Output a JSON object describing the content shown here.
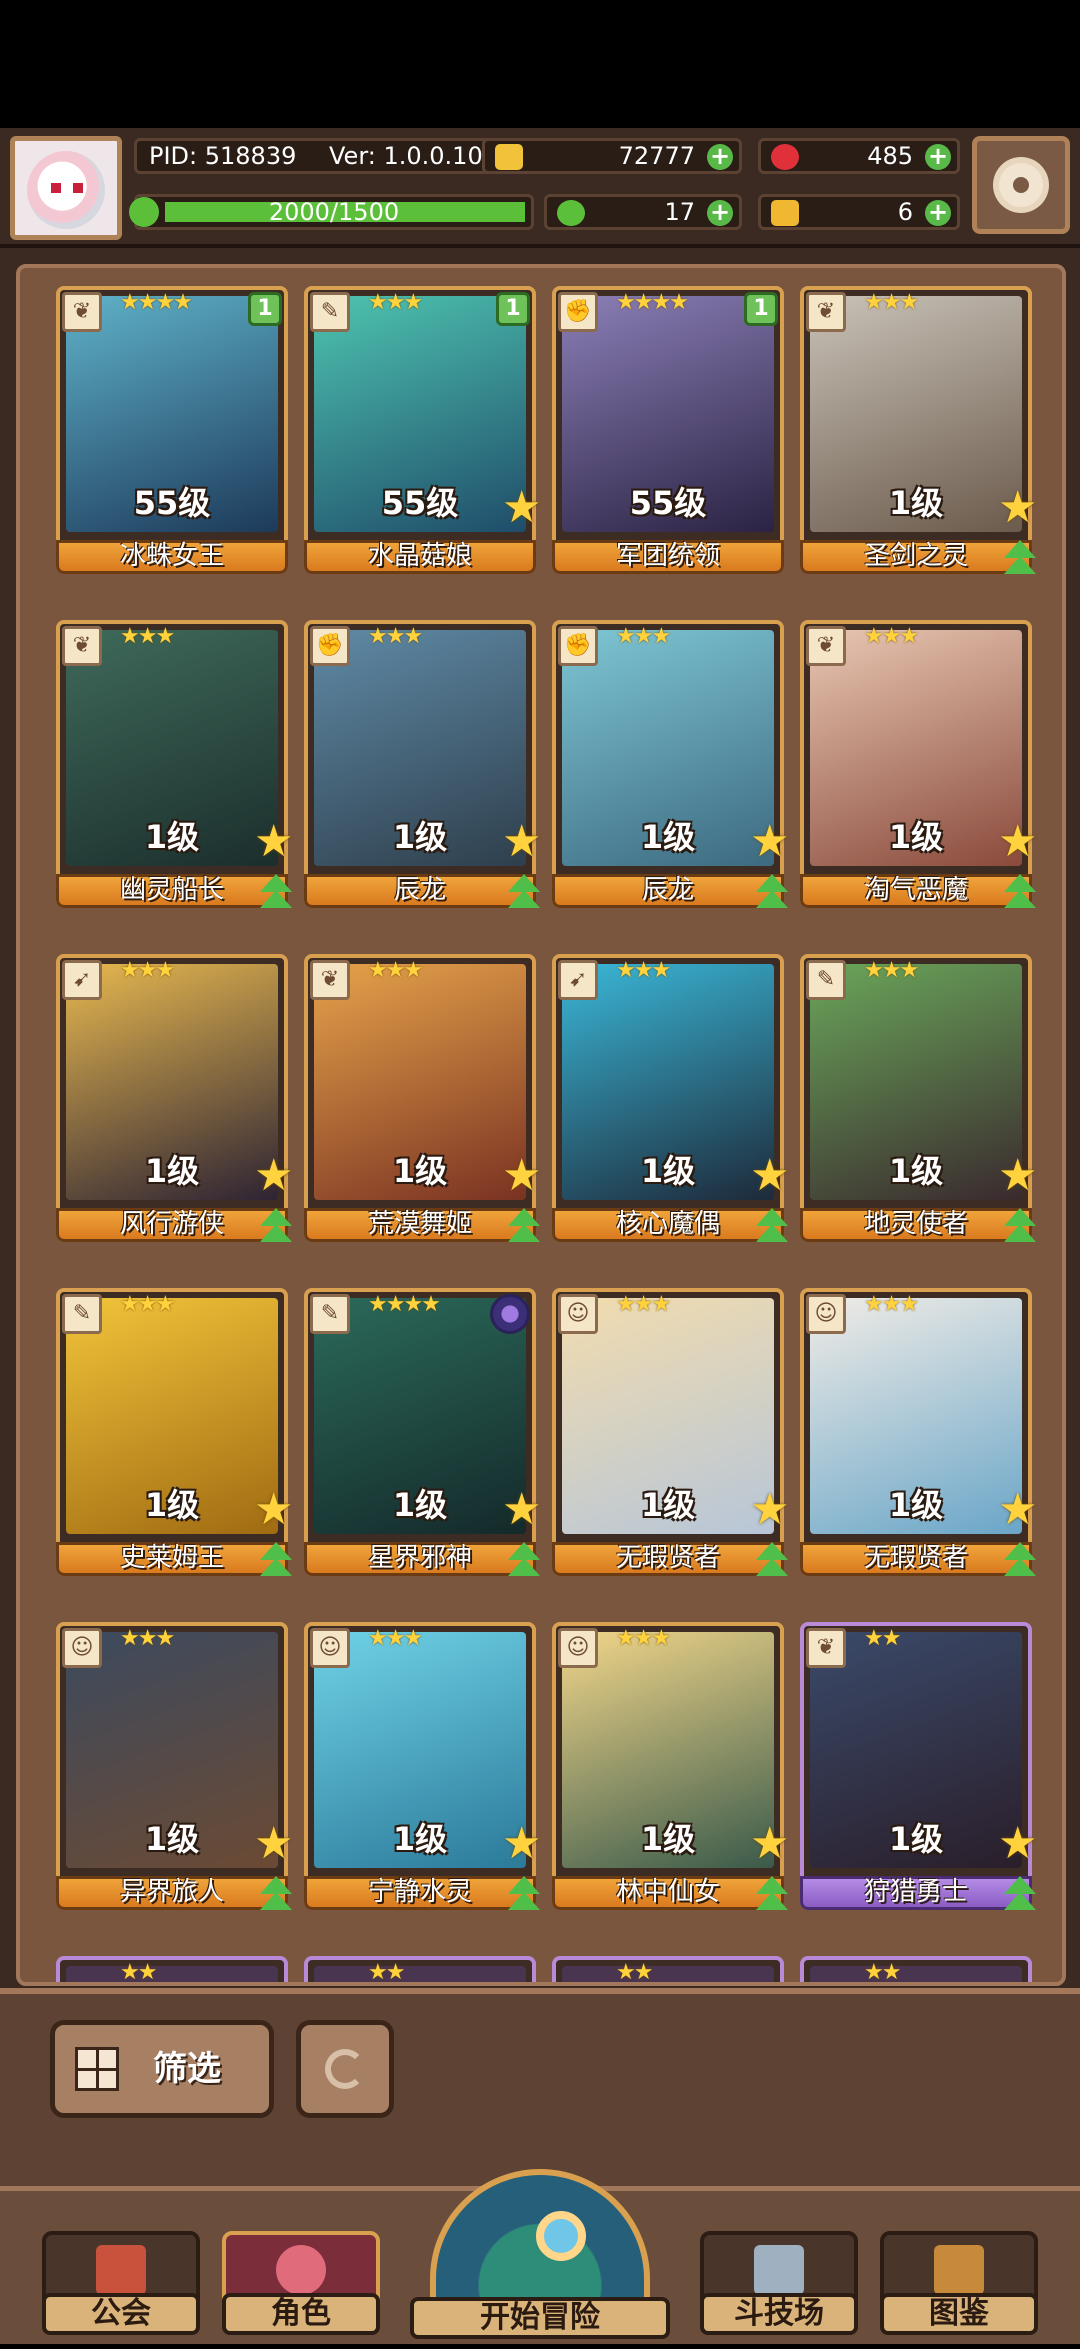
{
  "header": {
    "pid": "PID: 518839",
    "version": "Ver: 1.0.0.10",
    "gold": "72777",
    "gems": "485",
    "clover": "17",
    "keys": "6",
    "xp": "2000/1500",
    "xp_fraction": 1.0
  },
  "roster": {
    "cards": [
      {
        "name": "冰蛛女王",
        "level": "55级",
        "stars": "★★★★",
        "badge": "1",
        "type": "leaf",
        "colors": [
          "#5fb2c9",
          "#1d3a5a"
        ]
      },
      {
        "name": "水晶菇娘",
        "level": "55级",
        "stars": "★★★",
        "badge": "1",
        "type": "wand",
        "colors": [
          "#4ec4b0",
          "#1f4d6a"
        ]
      },
      {
        "name": "军团统领",
        "level": "55级",
        "stars": "★★★★",
        "badge": "1",
        "type": "fist",
        "colors": [
          "#8b7fb6",
          "#2b2344"
        ]
      },
      {
        "name": "圣剑之灵",
        "level": "1级",
        "stars": "★★★",
        "badge": "",
        "type": "leaf",
        "colors": [
          "#c9c2b8",
          "#6b5b4c"
        ]
      },
      {
        "name": "幽灵船长",
        "level": "1级",
        "stars": "★★★",
        "badge": "",
        "type": "leaf",
        "colors": [
          "#3f6a5a",
          "#1b2e2c"
        ]
      },
      {
        "name": "辰龙",
        "level": "1级",
        "stars": "★★★",
        "badge": "",
        "type": "fist",
        "colors": [
          "#5f8aa6",
          "#2e3f4c"
        ]
      },
      {
        "name": "辰龙",
        "level": "1级",
        "stars": "★★★",
        "badge": "",
        "type": "fist",
        "colors": [
          "#7ec6d4",
          "#3d6a80"
        ]
      },
      {
        "name": "淘气恶魔",
        "level": "1级",
        "stars": "★★★",
        "badge": "",
        "type": "leaf",
        "colors": [
          "#e8c7b2",
          "#8a4a3c"
        ]
      },
      {
        "name": "风行游侠",
        "level": "1级",
        "stars": "★★★",
        "badge": "",
        "type": "bow",
        "colors": [
          "#e7b84f",
          "#2d2333"
        ]
      },
      {
        "name": "荒漠舞姬",
        "level": "1级",
        "stars": "★★★",
        "badge": "",
        "type": "leaf",
        "colors": [
          "#e6a34a",
          "#7a3222"
        ]
      },
      {
        "name": "核心魔偶",
        "level": "1级",
        "stars": "★★★",
        "badge": "",
        "type": "bow",
        "colors": [
          "#3ab7d7",
          "#1d2a3a"
        ]
      },
      {
        "name": "地灵使者",
        "level": "1级",
        "stars": "★★★",
        "badge": "",
        "type": "wand",
        "colors": [
          "#6aa65a",
          "#3a2a2e"
        ]
      },
      {
        "name": "史莱姆王",
        "level": "1级",
        "stars": "★★★",
        "badge": "",
        "type": "wand",
        "colors": [
          "#f2c43a",
          "#a06b12"
        ]
      },
      {
        "name": "星界邪神",
        "level": "1级",
        "stars": "★★★★",
        "badge": "orb",
        "type": "wand",
        "colors": [
          "#2b6a5a",
          "#14292a"
        ]
      },
      {
        "name": "无瑕贤者",
        "level": "1级",
        "stars": "★★★",
        "badge": "",
        "type": "face",
        "colors": [
          "#f2dcae",
          "#b7c6d8"
        ]
      },
      {
        "name": "无瑕贤者",
        "level": "1级",
        "stars": "★★★",
        "badge": "",
        "type": "face",
        "colors": [
          "#f0ece6",
          "#6aa6c8"
        ]
      },
      {
        "name": "异界旅人",
        "level": "1级",
        "stars": "★★★",
        "badge": "",
        "type": "face",
        "colors": [
          "#3c4a5e",
          "#6b4a34"
        ]
      },
      {
        "name": "宁静水灵",
        "level": "1级",
        "stars": "★★★",
        "badge": "",
        "type": "face",
        "colors": [
          "#6fd2e6",
          "#2b7a9a"
        ]
      },
      {
        "name": "林中仙女",
        "level": "1级",
        "stars": "★★★",
        "badge": "",
        "type": "face",
        "colors": [
          "#f2d68a",
          "#3a5a4a"
        ]
      },
      {
        "name": "狩猎勇士",
        "level": "1级",
        "stars": "★★",
        "badge": "",
        "type": "leaf",
        "purple": true,
        "colors": [
          "#3a4a6a",
          "#2a1e2a"
        ]
      }
    ],
    "partial_row_stars": [
      "★★",
      "★★",
      "★★",
      "★★"
    ]
  },
  "controls": {
    "filter_label": "筛选"
  },
  "nav": {
    "guild": "公会",
    "characters": "角色",
    "start": "开始冒险",
    "arena": "斗技场",
    "codex": "图鉴"
  },
  "colors": {
    "gold_icon": "#f2c23a",
    "gem_icon": "#e0303a",
    "clover_icon": "#5cbf3a",
    "key_icon": "#f0b830",
    "card_border": "#d9a14f",
    "rare_border": "#b98ad8"
  }
}
